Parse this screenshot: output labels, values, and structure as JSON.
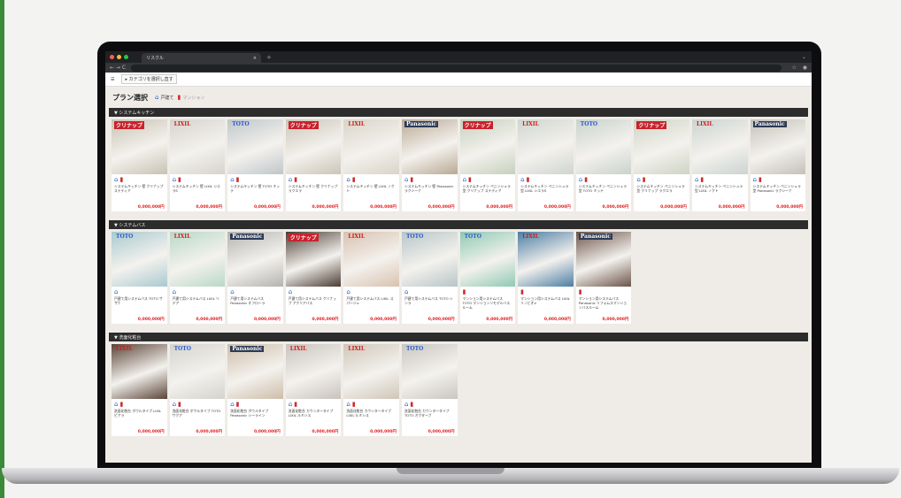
{
  "browser": {
    "tab_title": "リスクル",
    "tab_close": "×",
    "tab_plus": "+",
    "tab_menu": "⌄",
    "nav": "← → C",
    "star": "☆",
    "profile": "◉"
  },
  "topnav": {
    "menu_icon": "☰",
    "category_button": "▸ カテゴリを選択し直す"
  },
  "header": {
    "title": "プラン選択",
    "legend_house": "戸建て",
    "legend_mansion": "マンション"
  },
  "sections": [
    {
      "label": "▼ システムキッチン",
      "cards": [
        {
          "brand": "クリナップ",
          "brand_color": "#ffffff",
          "brand_bg": "#c9222c",
          "photo": "#c8c2b4",
          "icons": [
            "house",
            "reform"
          ],
          "name": "システムキッチン 壁 クリナップ ステディア",
          "price": "0,000,000円"
        },
        {
          "brand": "LIXIL",
          "brand_color": "#d11b1b",
          "brand_bg": "transparent",
          "photo": "#d6d3cd",
          "icons": [
            "house",
            "reform"
          ],
          "name": "システムキッチン 壁 LIXIL シエラS",
          "price": "0,000,000円"
        },
        {
          "brand": "TOTO",
          "brand_color": "#2a5bd0",
          "brand_bg": "transparent",
          "photo": "#bfc6c9",
          "icons": [
            "house",
            "reform"
          ],
          "name": "システムキッチン 壁 TOTO ミッテ",
          "price": "0,000,000円"
        },
        {
          "brand": "クリナップ",
          "brand_color": "#ffffff",
          "brand_bg": "#c9222c",
          "photo": "#cbc5b8",
          "icons": [
            "house",
            "reform"
          ],
          "name": "システムキッチン 壁 クリナップ ラクエラ",
          "price": "0,000,000円"
        },
        {
          "brand": "LIXIL",
          "brand_color": "#d11b1b",
          "brand_bg": "transparent",
          "photo": "#d9d4c9",
          "icons": [
            "house",
            "reform"
          ],
          "name": "システムキッチン 壁 LIXIL ノクト",
          "price": "0,000,000円"
        },
        {
          "brand": "Panasonic",
          "brand_color": "#ffffff",
          "brand_bg": "#2d3a55",
          "photo": "#b9a994",
          "icons": [
            "house",
            "reform"
          ],
          "name": "システムキッチン 壁 Panasonic ラクシーナ",
          "price": "0,000,000円"
        },
        {
          "brand": "クリナップ",
          "brand_color": "#ffffff",
          "brand_bg": "#c9222c",
          "photo": "#c5d0bd",
          "icons": [
            "house",
            "reform"
          ],
          "name": "システムキッチン ペニンシュラ型 クリナップ ステディア",
          "price": "0,000,000円"
        },
        {
          "brand": "LIXIL",
          "brand_color": "#d11b1b",
          "brand_bg": "transparent",
          "photo": "#cfd5cf",
          "icons": [
            "house",
            "reform"
          ],
          "name": "システムキッチン ペニンシュラ型 LIXIL シエラS",
          "price": "0,000,000円"
        },
        {
          "brand": "TOTO",
          "brand_color": "#2a5bd0",
          "brand_bg": "transparent",
          "photo": "#c9d2cc",
          "icons": [
            "house",
            "reform"
          ],
          "name": "システムキッチン ペニンシュラ型 TOTO ミッテ",
          "price": "0,000,000円"
        },
        {
          "brand": "クリナップ",
          "brand_color": "#ffffff",
          "brand_bg": "#c9222c",
          "photo": "#cdd4c4",
          "icons": [
            "house",
            "reform"
          ],
          "name": "システムキッチン ペニンシュラ型 クリナップ ラクエラ",
          "price": "0,000,000円"
        },
        {
          "brand": "LIXIL",
          "brand_color": "#d11b1b",
          "brand_bg": "transparent",
          "photo": "#cbd3d0",
          "icons": [
            "house",
            "reform"
          ],
          "name": "システムキッチン ペニンシュラ型 LIXIL ノクト",
          "price": "0,000,000円"
        },
        {
          "brand": "Panasonic",
          "brand_color": "#ffffff",
          "brand_bg": "#2d3a55",
          "photo": "#c4c0b8",
          "icons": [
            "house",
            "reform"
          ],
          "name": "システムキッチン ペニンシュラ型 Panasonic ラクシーナ",
          "price": "0,000,000円"
        }
      ]
    },
    {
      "label": "▼ システムバス",
      "cards": [
        {
          "brand": "TOTO",
          "brand_color": "#2a5bd0",
          "brand_bg": "transparent",
          "photo": "#a9c9cf",
          "icons": [
            "house"
          ],
          "name": "戸建て用システムバス TOTO サザナ",
          "price": "0,000,000円"
        },
        {
          "brand": "LIXIL",
          "brand_color": "#d11b1b",
          "brand_bg": "transparent",
          "photo": "#b9d8c8",
          "icons": [
            "house"
          ],
          "name": "戸建て用システムバス LIXIL リデア",
          "price": "0,000,000円"
        },
        {
          "brand": "Panasonic",
          "brand_color": "#ffffff",
          "brand_bg": "#2d3a55",
          "photo": "#b4b3b0",
          "icons": [
            "house"
          ],
          "name": "戸建て用システムバス Panasonic オフローラ",
          "price": "0,000,000円"
        },
        {
          "brand": "クリナップ",
          "brand_color": "#ffffff",
          "brand_bg": "#c9222c",
          "photo": "#4a3c32",
          "icons": [
            "house"
          ],
          "name": "戸建て用システムバス クリナップ アクリアバス",
          "price": "0,000,000円"
        },
        {
          "brand": "LIXIL",
          "brand_color": "#d11b1b",
          "brand_bg": "transparent",
          "photo": "#d8c2b0",
          "icons": [
            "house"
          ],
          "name": "戸建て用システムバス LIXIL スパージュ",
          "price": "0,000,000円"
        },
        {
          "brand": "TOTO",
          "brand_color": "#2a5bd0",
          "brand_bg": "transparent",
          "photo": "#b7c5c7",
          "icons": [
            "house"
          ],
          "name": "戸建て用システムバス TOTO シンラ",
          "price": "0,000,000円"
        },
        {
          "brand": "TOTO",
          "brand_color": "#2a5bd0",
          "brand_bg": "transparent",
          "photo": "#8fc9b4",
          "icons": [
            "reform"
          ],
          "name": "マンション用システムバス TOTO マンションリモデルバスルーム",
          "price": "0,000,000円"
        },
        {
          "brand": "LIXIL",
          "brand_color": "#d11b1b",
          "brand_bg": "transparent",
          "photo": "#4c7ea3",
          "icons": [
            "reform"
          ],
          "name": "マンション用システムバス LIXIL リノビオV",
          "price": "0,000,000円"
        },
        {
          "brand": "Panasonic",
          "brand_color": "#ffffff",
          "brand_bg": "#2d3a55",
          "photo": "#6b5448",
          "icons": [
            "reform"
          ],
          "name": "マンション用システムバス Panasonic リフォムスマンションバスルーム",
          "price": "0,000,000円"
        }
      ]
    },
    {
      "label": "▼ 洗面化粧台",
      "cards": [
        {
          "brand": "LIXIL",
          "brand_color": "#d11b1b",
          "brand_bg": "transparent",
          "photo": "#5a4438",
          "icons": [
            "house",
            "reform"
          ],
          "name": "洗面化粧台 ボウルタイプ LIXIL ピアラ",
          "price": "0,000,000円"
        },
        {
          "brand": "TOTO",
          "brand_color": "#2a5bd0",
          "brand_bg": "transparent",
          "photo": "#d5d3ce",
          "icons": [
            "house",
            "reform"
          ],
          "name": "洗面化粧台 ボウルタイプ TOTO サクア",
          "price": "0,000,000円"
        },
        {
          "brand": "Panasonic",
          "brand_color": "#ffffff",
          "brand_bg": "#2d3a55",
          "photo": "#cdbda9",
          "icons": [
            "house",
            "reform"
          ],
          "name": "洗面化粧台 ボウルタイプ Panasonic シーライン",
          "price": "0,000,000円"
        },
        {
          "brand": "LIXIL",
          "brand_color": "#d11b1b",
          "brand_bg": "transparent",
          "photo": "#c8c3bc",
          "icons": [
            "house",
            "reform"
          ],
          "name": "洗面化粧台 カウンタータイプ LIXIL ルミシス",
          "price": "0,000,000円"
        },
        {
          "brand": "LIXIL",
          "brand_color": "#d11b1b",
          "brand_bg": "transparent",
          "photo": "#cfc6b8",
          "icons": [
            "house",
            "reform"
          ],
          "name": "洗面化粧台 カウンタータイプ LIXIL ルミシス",
          "price": "0,000,000円"
        },
        {
          "brand": "TOTO",
          "brand_color": "#2a5bd0",
          "brand_bg": "transparent",
          "photo": "#c9c6c0",
          "icons": [
            "house",
            "reform"
          ],
          "name": "洗面化粧台 カウンタータイプ TOTO オクターブ",
          "price": "0,000,000円"
        }
      ]
    }
  ]
}
